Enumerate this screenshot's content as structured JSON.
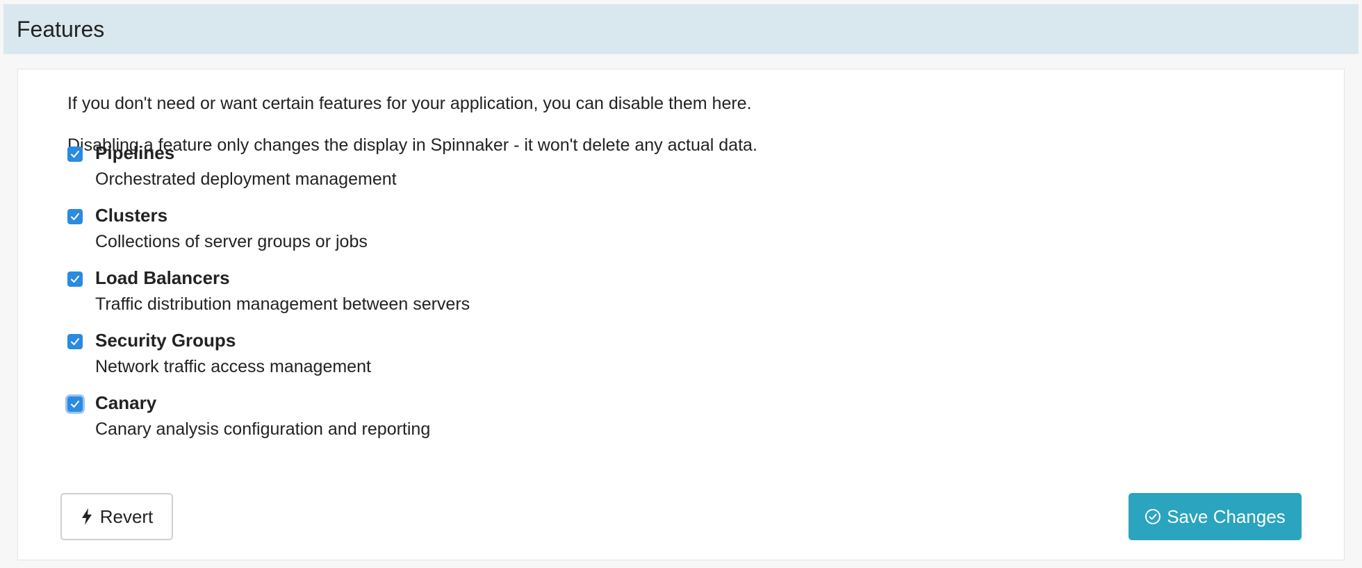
{
  "section": {
    "title": "Features"
  },
  "intro": {
    "line1": "If you don't need or want certain features for your application, you can disable them here.",
    "line2": "Disabling a feature only changes the display in Spinnaker - it won't delete any actual data."
  },
  "features": [
    {
      "name": "Pipelines",
      "description": "Orchestrated deployment management",
      "checked": true
    },
    {
      "name": "Clusters",
      "description": "Collections of server groups or jobs",
      "checked": true
    },
    {
      "name": "Load Balancers",
      "description": "Traffic distribution management between servers",
      "checked": true
    },
    {
      "name": "Security Groups",
      "description": "Network traffic access management",
      "checked": true
    },
    {
      "name": "Canary",
      "description": "Canary analysis configuration and reporting",
      "checked": true,
      "focused": true
    }
  ],
  "buttons": {
    "revert_label": "Revert",
    "revert_icon": "lightning-bolt-icon",
    "save_label": "Save Changes",
    "save_icon": "check-circle-icon"
  },
  "colors": {
    "header_bg": "#d9e8ee",
    "checkbox": "#2a8be0",
    "save_button": "#2aa4bf"
  }
}
